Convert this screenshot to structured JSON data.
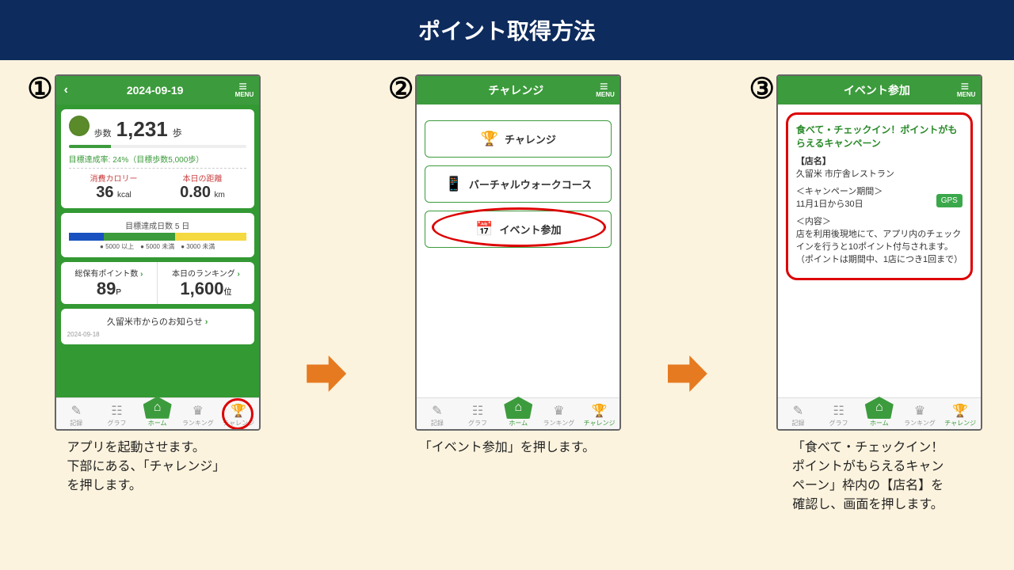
{
  "title": "ポイント取得方法",
  "steps": {
    "s1": {
      "num": "①"
    },
    "s2": {
      "num": "②"
    },
    "s3": {
      "num": "③"
    }
  },
  "phone1": {
    "date": "2024-09-19",
    "menu": "MENU",
    "steps_label": "歩数",
    "steps_value": "1,231",
    "steps_unit": "歩",
    "goal_line": "目標達成率: 24%（目標歩数5,000歩）",
    "cal_label": "消費カロリー",
    "cal_value": "36",
    "cal_unit": "kcal",
    "dist_label": "本日の距離",
    "dist_value": "0.80",
    "dist_unit": "km",
    "days_title": "目標達成日数 5 日",
    "legend": "● 5000 以上　● 5000 未満　● 3000 未満",
    "pts_label": "総保有ポイント数",
    "pts_value": "89",
    "pts_unit": "P",
    "rank_label": "本日のランキング",
    "rank_value": "1,600",
    "rank_unit": "位",
    "notice": "久留米市からのお知らせ",
    "notice_date": "2024-09-18"
  },
  "tabs": {
    "record": "記録",
    "graph": "グラフ",
    "home": "ホーム",
    "ranking": "ランキング",
    "challenge": "チャレンジ"
  },
  "phone2": {
    "title": "チャレンジ",
    "btn1": "チャレンジ",
    "btn2": "バーチャルウォークコース",
    "btn3": "イベント参加"
  },
  "phone3": {
    "title": "イベント参加",
    "ev_title": "食べて・チェックイン！ポイントがもらえるキャンペーン",
    "shop_h": "【店名】",
    "shop": "久留米 市庁舎レストラン",
    "period_h": "＜キャンペーン期間＞",
    "period": "11月1日から30日",
    "gps": "GPS",
    "content_h": "＜内容＞",
    "content": "店を利用後現地にて、アプリ内のチェックインを行うと10ポイント付与されます。（ポイントは期間中、1店につき1回まで）"
  },
  "captions": {
    "c1": "アプリを起動させます。\n下部にある、「チャレンジ」\nを押します。",
    "c2": "「イベント参加」を押します。",
    "c3": "「食べて・チェックイン！\nポイントがもらえるキャン\nペーン」枠内の【店名】を\n確認し、画面を押します。"
  }
}
